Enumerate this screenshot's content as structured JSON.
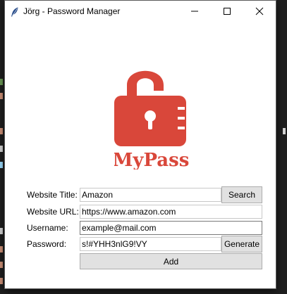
{
  "window": {
    "title": "Jörg - Password Manager",
    "controls": {
      "minimize": "minimize-icon",
      "maximize": "maximize-icon",
      "close": "close-icon"
    }
  },
  "logo": {
    "text": "MyPass",
    "icon": "unlocked-padlock-icon",
    "color": "#d9473a"
  },
  "form": {
    "website_title": {
      "label": "Website Title:",
      "value": "Amazon"
    },
    "website_url": {
      "label": "Website URL:",
      "value": "https://www.amazon.com"
    },
    "username": {
      "label": "Username:",
      "value": "example@mail.com"
    },
    "password": {
      "label": "Password:",
      "value": "s!#YHH3nlG9!VY"
    }
  },
  "buttons": {
    "search": "Search",
    "generate": "Generate",
    "add": "Add"
  }
}
